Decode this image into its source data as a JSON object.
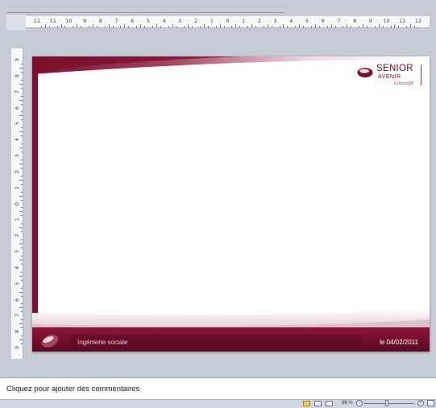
{
  "rulers": {
    "horizontal_labels": [
      "12",
      "11",
      "10",
      "9",
      "8",
      "7",
      "6",
      "5",
      "4",
      "3",
      "2",
      "1",
      "0",
      "1",
      "2",
      "3",
      "4",
      "5",
      "6",
      "7",
      "8",
      "9",
      "10",
      "11",
      "12"
    ],
    "vertical_labels": [
      "9",
      "8",
      "7",
      "6",
      "5",
      "4",
      "3",
      "2",
      "1",
      "0",
      "1",
      "2",
      "3",
      "4",
      "5",
      "6",
      "7",
      "8",
      "9"
    ]
  },
  "slide": {
    "logo": {
      "name": "SENIOR",
      "sub": "AVENIR",
      "tagline": "concept"
    },
    "footer_title": "Ingénierie sociale",
    "footer_date": "le 04/02/2011"
  },
  "notes": {
    "placeholder": "Cliquez pour ajouter des commentaires"
  },
  "status_bar": {
    "zoom": "86 %",
    "zoom_minus": "−",
    "zoom_plus": "+"
  },
  "colors": {
    "accent": "#7a0f2e",
    "accent_dark": "#5a0a22",
    "workspace": "#c5ccd6"
  }
}
